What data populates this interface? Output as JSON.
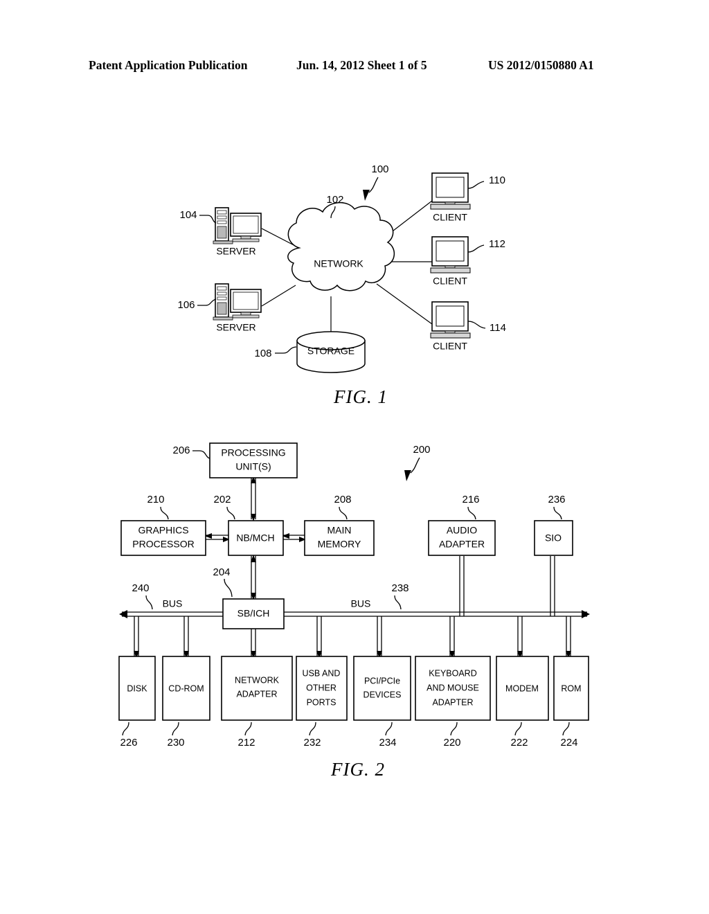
{
  "header": {
    "title": "Patent Application Publication",
    "date_sheet": "Jun. 14, 2012  Sheet 1 of 5",
    "publication_number": "US 2012/0150880 A1"
  },
  "figure1": {
    "caption": "FIG. 1",
    "system_ref": "100",
    "nodes": {
      "network": {
        "label": "NETWORK",
        "ref": "102"
      },
      "server_top": {
        "label": "SERVER",
        "ref": "104"
      },
      "server_bottom": {
        "label": "SERVER",
        "ref": "106"
      },
      "storage": {
        "label": "STORAGE",
        "ref": "108"
      },
      "client_top": {
        "label": "CLIENT",
        "ref": "110"
      },
      "client_middle": {
        "label": "CLIENT",
        "ref": "112"
      },
      "client_bottom": {
        "label": "CLIENT",
        "ref": "114"
      }
    }
  },
  "figure2": {
    "caption": "FIG. 2",
    "system_ref": "200",
    "bus_label_left": "BUS",
    "bus_label_right": "BUS",
    "bus_ref_left": "240",
    "bus_ref_right": "238",
    "processing_unit": {
      "line1": "PROCESSING",
      "line2": "UNIT(S)",
      "ref": "206"
    },
    "northbridge": {
      "label": "NB/MCH",
      "ref": "202"
    },
    "southbridge": {
      "label": "SB/ICH",
      "ref": "204"
    },
    "graphics_processor": {
      "line1": "GRAPHICS",
      "line2": "PROCESSOR",
      "ref": "210"
    },
    "main_memory": {
      "line1": "MAIN",
      "line2": "MEMORY",
      "ref": "208"
    },
    "audio_adapter": {
      "line1": "AUDIO",
      "line2": "ADAPTER",
      "ref": "216"
    },
    "sio": {
      "label": "SIO",
      "ref": "236"
    },
    "devices": [
      {
        "lines": [
          "DISK"
        ],
        "ref": "226"
      },
      {
        "lines": [
          "CD-ROM"
        ],
        "ref": "230"
      },
      {
        "lines": [
          "NETWORK",
          "ADAPTER"
        ],
        "ref": "212"
      },
      {
        "lines": [
          "USB AND",
          "OTHER",
          "PORTS"
        ],
        "ref": "232"
      },
      {
        "lines": [
          "PCI/PCIe",
          "DEVICES"
        ],
        "ref": "234"
      },
      {
        "lines": [
          "KEYBOARD",
          "AND MOUSE",
          "ADAPTER"
        ],
        "ref": "220"
      },
      {
        "lines": [
          "MODEM"
        ],
        "ref": "222"
      },
      {
        "lines": [
          "ROM"
        ],
        "ref": "224"
      }
    ]
  },
  "colors": {
    "ink": "#000000",
    "paper": "#ffffff"
  }
}
